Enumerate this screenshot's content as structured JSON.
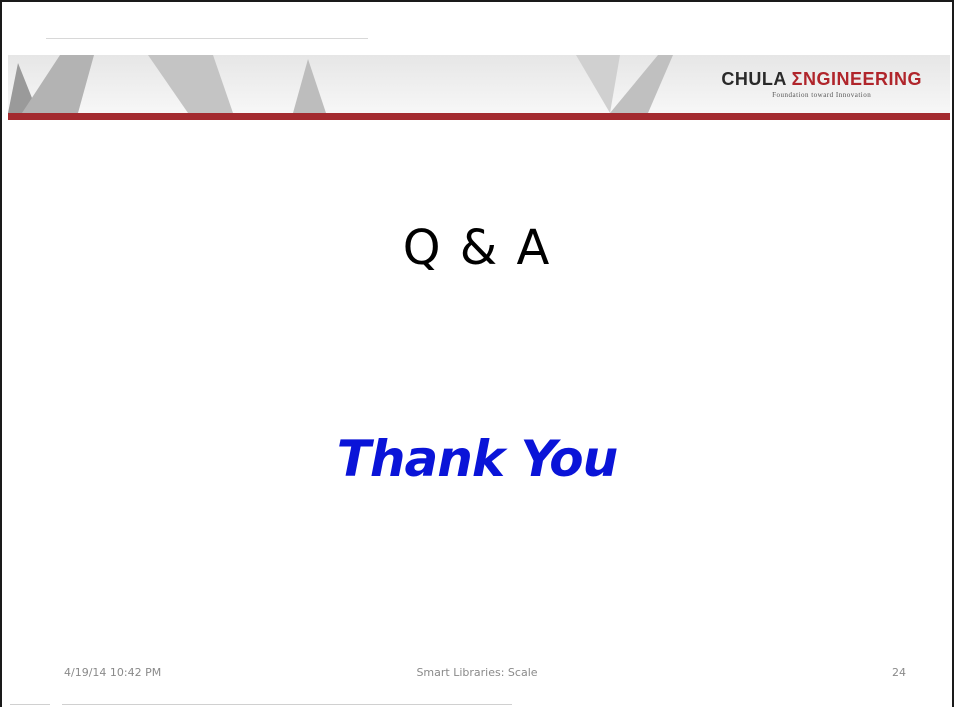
{
  "header": {
    "brand_chula": "CHULA",
    "brand_engineering": "ΣNGINEERING",
    "brand_tagline": "Foundation toward Innovation"
  },
  "slide": {
    "title": "Q & A",
    "subtitle": "Thank You"
  },
  "footer": {
    "date": "4/19/14 10:42 PM",
    "title": "Smart Libraries: Scale",
    "slide_number": "24"
  },
  "colors": {
    "accent_red": "#a32a2f",
    "thanks_blue": "#0a14d8"
  }
}
